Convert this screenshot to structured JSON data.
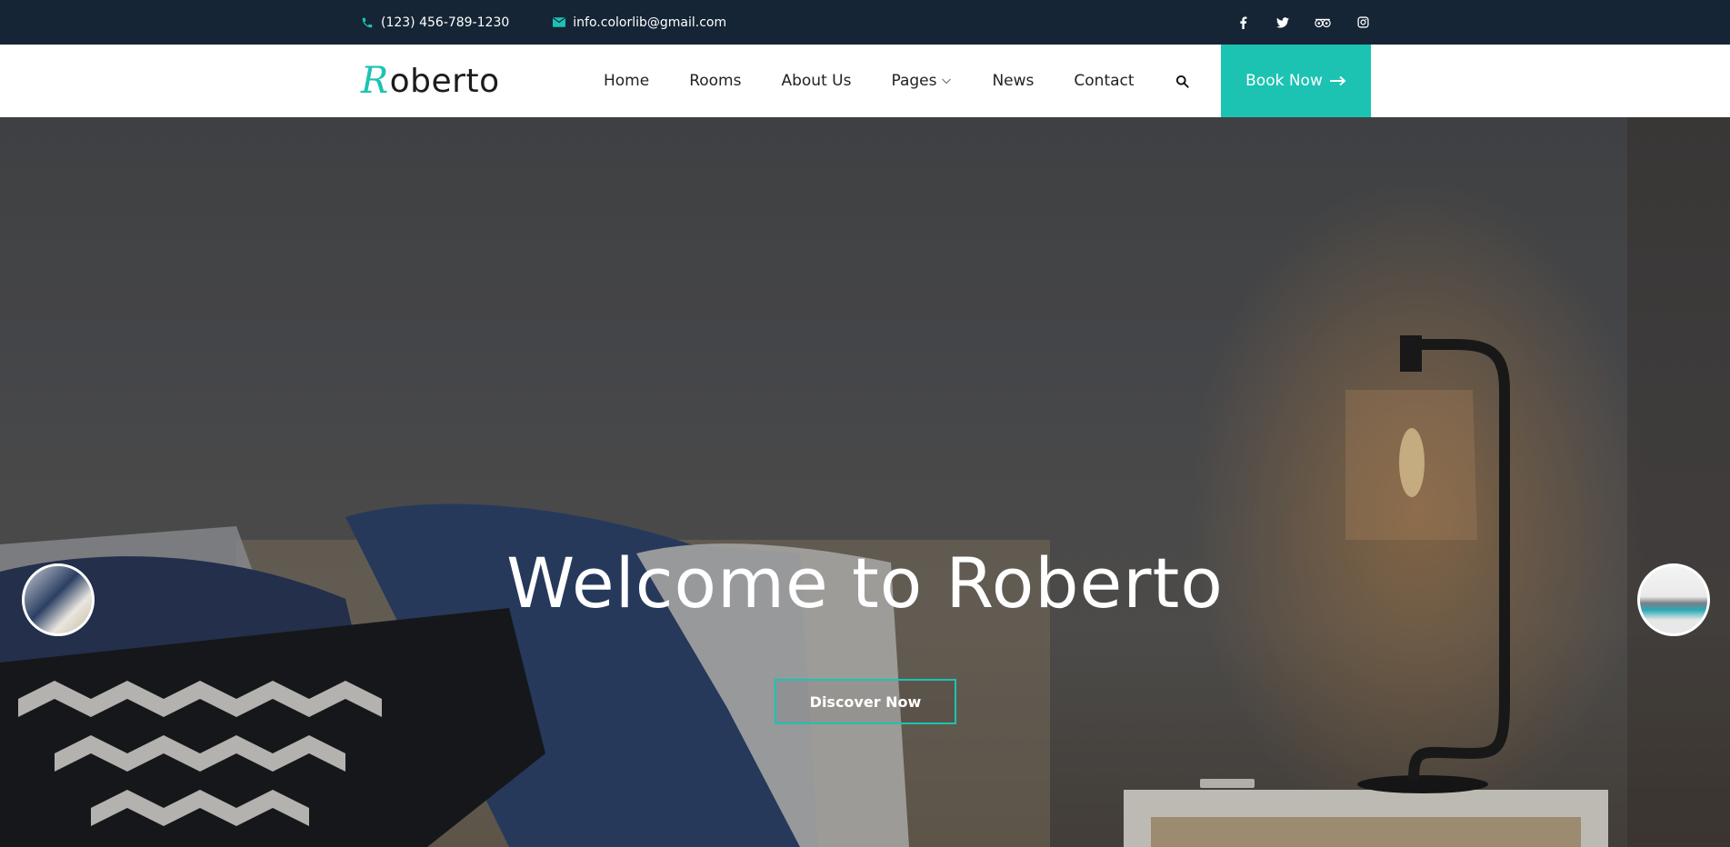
{
  "topbar": {
    "phone": "(123) 456-789-1230",
    "email": "info.colorlib@gmail.com",
    "phone_icon": "phone-icon",
    "email_icon": "envelope-icon",
    "social_icons": [
      "facebook-icon",
      "twitter-icon",
      "tripadvisor-icon",
      "instagram-icon"
    ]
  },
  "header": {
    "logo_initial": "R",
    "logo_rest": "oberto",
    "nav": [
      {
        "label": "Home"
      },
      {
        "label": "Rooms"
      },
      {
        "label": "About Us"
      },
      {
        "label": "Pages",
        "has_dropdown": true
      },
      {
        "label": "News"
      },
      {
        "label": "Contact"
      }
    ],
    "search_icon": "search-icon",
    "book_label": "Book Now",
    "book_icon": "arrow-right-icon"
  },
  "hero": {
    "title": "Welcome to Roberto",
    "cta_label": "Discover Now",
    "prev_thumb": "prev-slide-thumbnail",
    "next_thumb": "next-slide-thumbnail"
  },
  "colors": {
    "accent": "#1cc3b2",
    "topbar_bg": "#152536",
    "header_bg": "#ffffff",
    "text_dark": "#222222"
  }
}
